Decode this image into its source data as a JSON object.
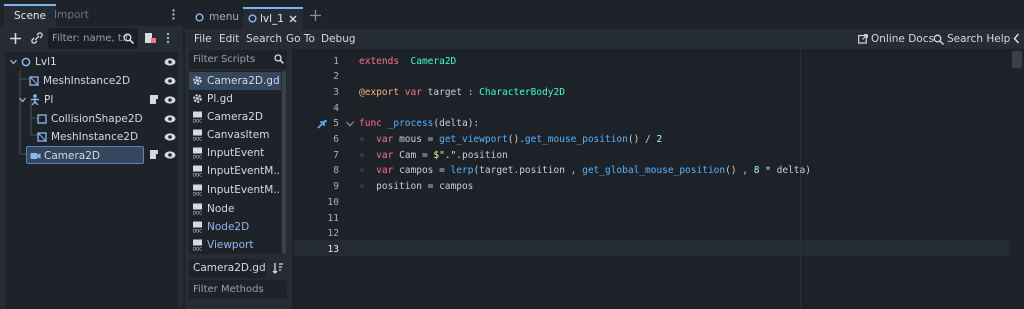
{
  "scene_dock": {
    "tabs": [
      "Scene",
      "Import"
    ],
    "filter_placeholder": "Filter: name, t:t",
    "tree": [
      {
        "label": "Lvl1"
      },
      {
        "label": "MeshInstance2D"
      },
      {
        "label": "Pl"
      },
      {
        "label": "CollisionShape2D"
      },
      {
        "label": "MeshInstance2D"
      },
      {
        "label": "Camera2D"
      }
    ]
  },
  "editor_tabs": [
    "menu",
    "lvl_1"
  ],
  "menubar": {
    "items": [
      "File",
      "Edit",
      "Search",
      "Go To",
      "Debug"
    ],
    "online_docs": "Online Docs",
    "search_help": "Search Help"
  },
  "scripts_panel": {
    "filter_scripts": "Filter Scripts",
    "items": [
      {
        "label": "Camera2D.gd",
        "icon": "gear-icon"
      },
      {
        "label": "Pl.gd",
        "icon": "gear-icon"
      },
      {
        "label": "Camera2D",
        "icon": "doc-icon"
      },
      {
        "label": "CanvasItem",
        "icon": "doc-icon"
      },
      {
        "label": "InputEvent",
        "icon": "doc-icon"
      },
      {
        "label": "InputEventM...",
        "icon": "doc-icon"
      },
      {
        "label": "InputEventM...",
        "icon": "doc-icon"
      },
      {
        "label": "Node",
        "icon": "doc-icon"
      },
      {
        "label": "Node2D",
        "icon": "doc-icon"
      },
      {
        "label": "Viewport",
        "icon": "doc-icon"
      }
    ],
    "current_script": "Camera2D.gd",
    "filter_methods": "Filter Methods"
  },
  "code": {
    "line_numbers": [
      "1",
      "2",
      "3",
      "4",
      "5",
      "6",
      "7",
      "8",
      "9",
      "10",
      "11",
      "12",
      "13"
    ],
    "lines": [
      [
        [
          "kw",
          "extends"
        ],
        [
          "",
          "  "
        ],
        [
          "ty",
          "Camera2D"
        ]
      ],
      [],
      [
        [
          "an",
          "@export"
        ],
        [
          "",
          " "
        ],
        [
          "kw",
          "var"
        ],
        [
          "",
          " target : "
        ],
        [
          "ty",
          "CharacterBody2D"
        ]
      ],
      [],
      [
        [
          "kw",
          "func"
        ],
        [
          "",
          " "
        ],
        [
          "fn",
          "_process"
        ],
        [
          "",
          "(delta):"
        ]
      ],
      [
        [
          "tabmark",
          "»  "
        ],
        [
          "kw",
          "var"
        ],
        [
          "",
          " mous = "
        ],
        [
          "fn",
          "get_viewport"
        ],
        [
          "",
          "()."
        ],
        [
          "fn",
          "get_mouse_position"
        ],
        [
          "",
          "() / "
        ],
        [
          "nm",
          "2"
        ]
      ],
      [
        [
          "tabmark",
          "»  "
        ],
        [
          "kw",
          "var"
        ],
        [
          "",
          " Cam = "
        ],
        [
          "st",
          "$\".\""
        ],
        [
          "",
          ".position"
        ]
      ],
      [
        [
          "tabmark",
          "»  "
        ],
        [
          "kw",
          "var"
        ],
        [
          "",
          " campos = "
        ],
        [
          "fn",
          "lerp"
        ],
        [
          "",
          "(target.position , "
        ],
        [
          "fn",
          "get_global_mouse_position"
        ],
        [
          "",
          "() , "
        ],
        [
          "nm",
          "8"
        ],
        [
          "",
          " * delta)"
        ]
      ],
      [
        [
          "tabmark",
          "»  "
        ],
        [
          "",
          "position = campos"
        ]
      ],
      [],
      [],
      [],
      []
    ]
  },
  "colors": {
    "accent": "#7fb2f0",
    "selection": "#33465e",
    "keyword": "#ff7085",
    "type": "#42ffc2",
    "function": "#57b3ff"
  }
}
